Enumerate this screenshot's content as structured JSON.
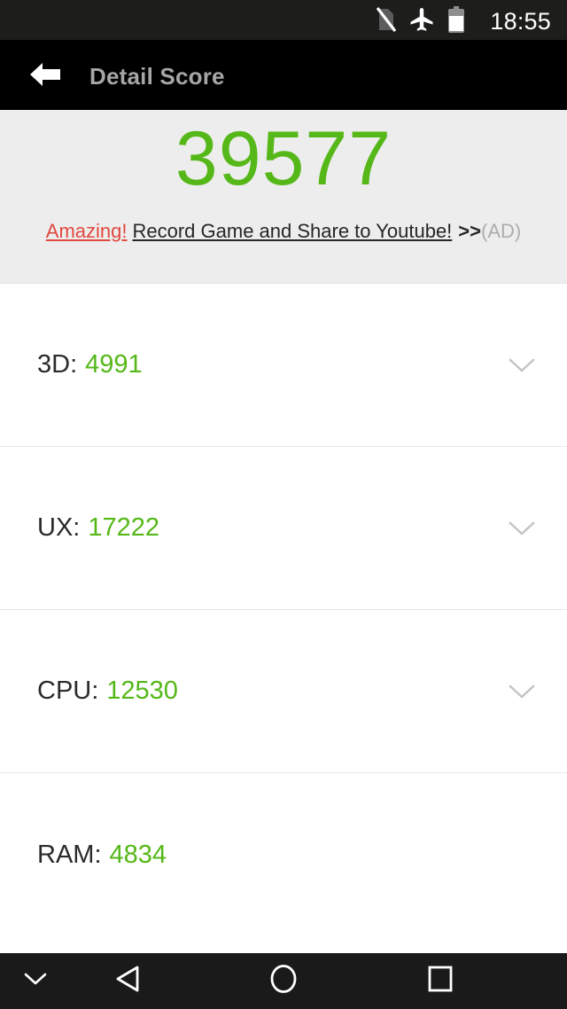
{
  "status_bar": {
    "clock": "18:55",
    "icons": [
      {
        "name": "no-sim-icon",
        "label": "No SIM"
      },
      {
        "name": "airplane-mode-icon",
        "label": "Airplane mode"
      },
      {
        "name": "battery-icon",
        "label": "Battery"
      }
    ]
  },
  "title_bar": {
    "back_label": "Back",
    "title": "Detail Score"
  },
  "score_panel": {
    "total_score": "39577",
    "ad": {
      "highlight": "Amazing!",
      "message": "Record Game and Share to Youtube!",
      "arrows": ">>",
      "tag": "(AD)"
    }
  },
  "detail_list": {
    "rows": [
      {
        "label": "3D:",
        "value": "4991",
        "expandable": true
      },
      {
        "label": "UX:",
        "value": "17222",
        "expandable": true
      },
      {
        "label": "CPU:",
        "value": "12530",
        "expandable": true
      },
      {
        "label": "RAM:",
        "value": "4834",
        "expandable": false
      }
    ]
  },
  "nav_bar": {
    "buttons": [
      {
        "name": "nav-hide-keyboard",
        "label": "Hide"
      },
      {
        "name": "nav-back",
        "label": "Back"
      },
      {
        "name": "nav-home",
        "label": "Home"
      },
      {
        "name": "nav-recents",
        "label": "Recents"
      }
    ]
  },
  "colors": {
    "score_green": "#55b818",
    "ad_red": "#e0493f",
    "panel_bg": "#ededed",
    "title_bar_bg": "#000000",
    "status_bar_bg": "#1d1d1b",
    "nav_bar_bg": "#1a1a1a",
    "label_dark": "#2b2b2b",
    "tag_gray": "#adadad"
  }
}
